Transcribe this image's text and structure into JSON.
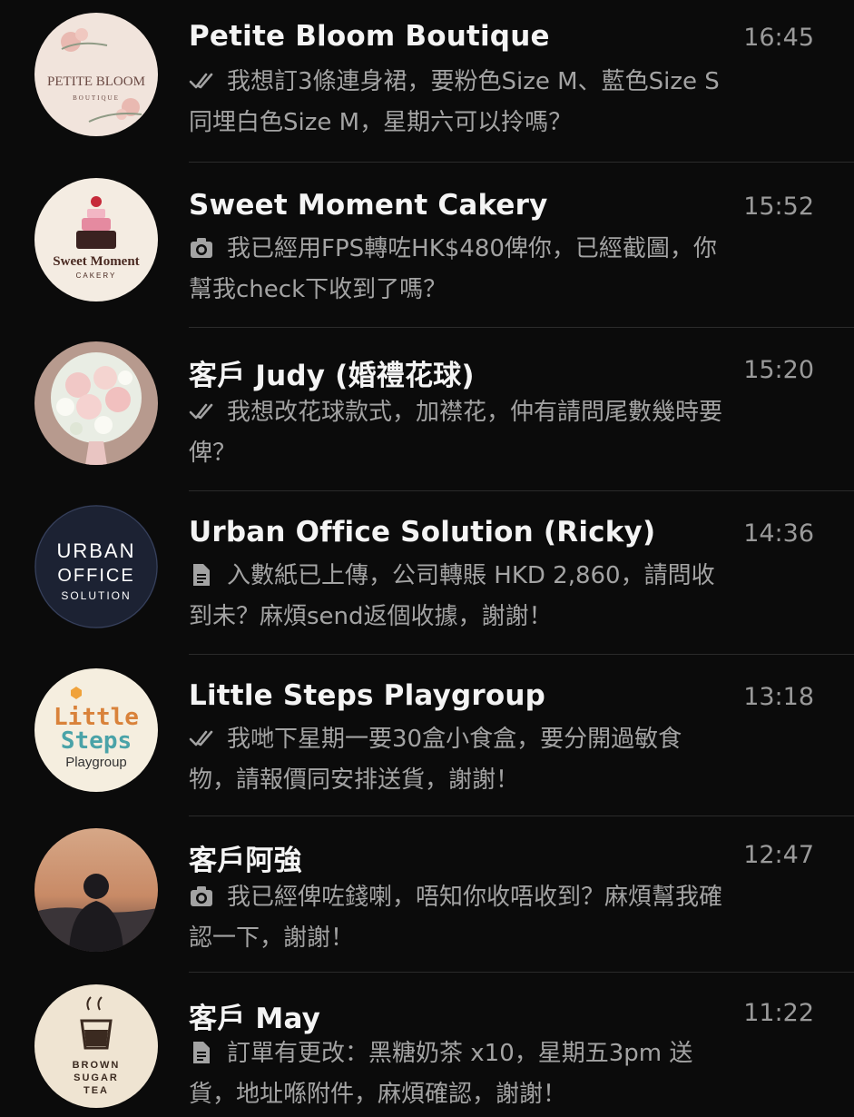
{
  "chats": [
    {
      "name": "Petite Bloom Boutique",
      "time": "16:45",
      "status_icon": "double-check-icon",
      "preview": "我想訂3條連身裙，要粉色Size M、藍色Size S 同埋白色Size M，星期六可以拎嗎？",
      "avatar": {
        "line1": "PETITE BLOOM",
        "line2": "BOUTIQUE",
        "bg": "#f1e4dc",
        "fg": "#6b4a44"
      }
    },
    {
      "name": "Sweet Moment Cakery",
      "time": "15:52",
      "status_icon": "camera-icon",
      "preview": "我已經用FPS轉咗HK$480俾你，已經截圖，你幫我check下收到了嗎？",
      "avatar": {
        "line1": "Sweet Moment",
        "line2": "CAKERY",
        "bg": "#f4ece2",
        "fg": "#4a2a22"
      }
    },
    {
      "name": "客戶 Judy (婚禮花球)",
      "time": "15:20",
      "status_icon": "double-check-icon",
      "preview": "我想改花球款式，加襟花，仲有請問尾數幾時要俾？",
      "avatar": {
        "bg": "#b79a8e"
      }
    },
    {
      "name": "Urban Office Solution (Ricky)",
      "time": "14:36",
      "status_icon": "document-icon",
      "preview": "入數紙已上傳，公司轉賬 HKD 2,860，請問收到未？麻煩send返個收據，謝謝！",
      "avatar": {
        "line1": "URBAN",
        "line2": "OFFICE",
        "line3": "SOLUTION",
        "bg": "#1c2233",
        "fg": "#ffffff"
      }
    },
    {
      "name": "Little Steps Playgroup",
      "time": "13:18",
      "status_icon": "double-check-icon",
      "preview": "我哋下星期一要30盒小食盒，要分開過敏食物，請報價同安排送貨，謝謝！",
      "avatar": {
        "line1": "Little",
        "line2": "Steps",
        "line3": "Playgroup",
        "bg": "#f5eedf",
        "fg": "#333333"
      }
    },
    {
      "name": "客戶阿強",
      "time": "12:47",
      "status_icon": "camera-icon",
      "preview": "我已經俾咗錢喇，唔知你收唔收到？麻煩幫我確認一下，謝謝！",
      "avatar": {
        "bg": "#c99470"
      }
    },
    {
      "name": "客戶 May",
      "time": "11:22",
      "status_icon": "document-icon",
      "preview": "訂單有更改：黑糖奶茶 x10，星期五3pm 送貨，地址喺附件，麻煩確認，謝謝！",
      "avatar": {
        "line1": "BROWN",
        "line2": "SUGAR",
        "line3": "TEA",
        "bg": "#efe4d2",
        "fg": "#3b2a20"
      }
    }
  ]
}
